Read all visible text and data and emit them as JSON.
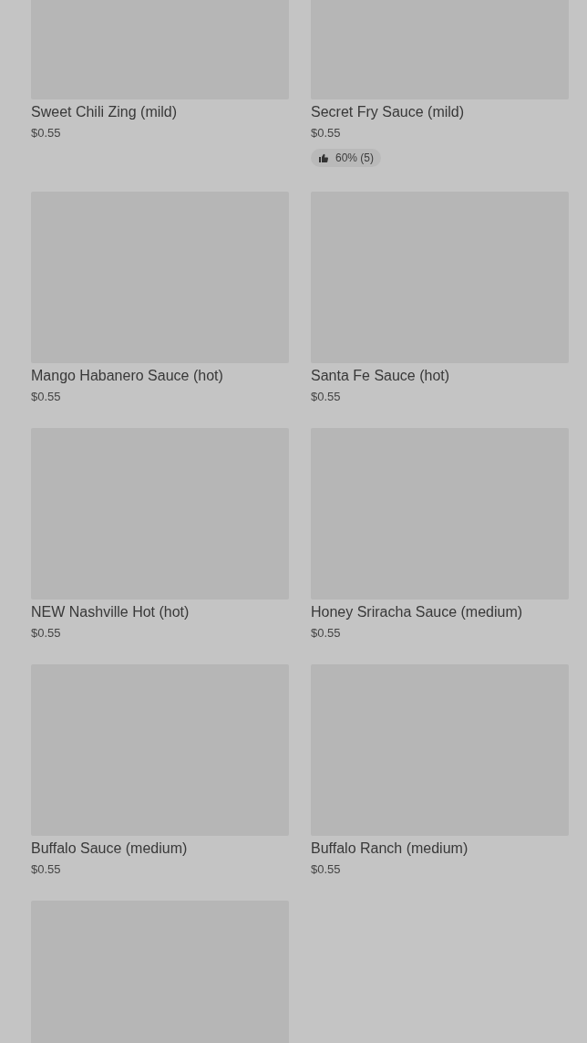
{
  "items": [
    {
      "kind": "product",
      "name": "Sweet Chili Zing (mild)",
      "price": "$0.55"
    },
    {
      "kind": "product",
      "name": "Secret Fry Sauce (mild)",
      "price": "$0.55",
      "rating": "60% (5)"
    },
    {
      "kind": "product",
      "name": "Mango Habanero Sauce (hot)",
      "price": "$0.55"
    },
    {
      "kind": "product",
      "name": "Santa Fe Sauce (hot)",
      "price": "$0.55"
    },
    {
      "kind": "product",
      "name": "NEW Nashville Hot (hot)",
      "price": "$0.55"
    },
    {
      "kind": "product",
      "name": "Honey Sriracha Sauce (medium)",
      "price": "$0.55"
    },
    {
      "kind": "product",
      "name": "Buffalo Sauce (medium)",
      "price": "$0.55"
    },
    {
      "kind": "product",
      "name": "Buffalo Ranch (medium)",
      "price": "$0.55"
    },
    {
      "kind": "image_only"
    }
  ]
}
